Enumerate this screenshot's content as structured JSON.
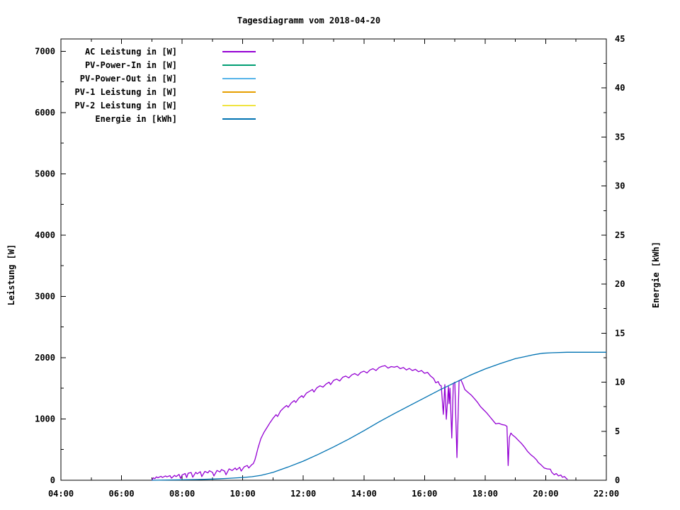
{
  "title": "Tagesdiagramm vom 2018-04-20",
  "chart_data": {
    "type": "line",
    "title": "Tagesdiagramm vom 2018-04-20",
    "grid": false,
    "legend_position": "top-left-inside",
    "x_axis": {
      "label": "",
      "unit": "time",
      "range_hours": [
        4,
        22
      ],
      "major_ticks": [
        {
          "t": 4,
          "label": "04:00"
        },
        {
          "t": 6,
          "label": "06:00"
        },
        {
          "t": 8,
          "label": "08:00"
        },
        {
          "t": 10,
          "label": "10:00"
        },
        {
          "t": 12,
          "label": "12:00"
        },
        {
          "t": 14,
          "label": "14:00"
        },
        {
          "t": 16,
          "label": "16:00"
        },
        {
          "t": 18,
          "label": "18:00"
        },
        {
          "t": 20,
          "label": "20:00"
        },
        {
          "t": 22,
          "label": "22:00"
        }
      ],
      "minor_ticks": [
        5,
        7,
        9,
        11,
        13,
        15,
        17,
        19,
        21
      ]
    },
    "y_axis_left": {
      "label": "Leistung [W]",
      "range": [
        0,
        7200
      ],
      "major_ticks": [
        {
          "v": 0,
          "label": "0"
        },
        {
          "v": 1000,
          "label": "1000"
        },
        {
          "v": 2000,
          "label": "2000"
        },
        {
          "v": 3000,
          "label": "3000"
        },
        {
          "v": 4000,
          "label": "4000"
        },
        {
          "v": 5000,
          "label": "5000"
        },
        {
          "v": 6000,
          "label": "6000"
        },
        {
          "v": 7000,
          "label": "7000"
        }
      ],
      "minor_ticks": [
        500,
        1500,
        2500,
        3500,
        4500,
        5500,
        6500
      ]
    },
    "y_axis_right": {
      "label": "Energie [kWh]",
      "range": [
        0,
        45
      ],
      "major_ticks": [
        {
          "v": 0,
          "label": "0"
        },
        {
          "v": 5,
          "label": "5"
        },
        {
          "v": 10,
          "label": "10"
        },
        {
          "v": 15,
          "label": "15"
        },
        {
          "v": 20,
          "label": "20"
        },
        {
          "v": 25,
          "label": "25"
        },
        {
          "v": 30,
          "label": "30"
        },
        {
          "v": 35,
          "label": "35"
        },
        {
          "v": 40,
          "label": "40"
        },
        {
          "v": 45,
          "label": "45"
        }
      ],
      "minor_ticks": [
        2.5,
        7.5,
        12.5,
        17.5,
        22.5,
        27.5,
        32.5,
        37.5,
        42.5
      ]
    },
    "legend": [
      {
        "label": "AC Leistung in [W]",
        "color": "#9400D3"
      },
      {
        "label": "PV-Power-In in [W]",
        "color": "#009E73"
      },
      {
        "label": "PV-Power-Out in [W]",
        "color": "#56B4E9"
      },
      {
        "label": "PV-1 Leistung in [W]",
        "color": "#E69F00"
      },
      {
        "label": "PV-2 Leistung in [W]",
        "color": "#F0E442"
      },
      {
        "label": "Energie in [kWh]",
        "color": "#0072B2"
      }
    ],
    "series": [
      {
        "name": "AC Leistung in [W]",
        "axis": "left",
        "color": "#9400D3",
        "points": [
          [
            7.0,
            0
          ],
          [
            7.05,
            40
          ],
          [
            7.1,
            25
          ],
          [
            7.15,
            55
          ],
          [
            7.2,
            40
          ],
          [
            7.3,
            65
          ],
          [
            7.35,
            45
          ],
          [
            7.45,
            70
          ],
          [
            7.5,
            55
          ],
          [
            7.6,
            75
          ],
          [
            7.65,
            35
          ],
          [
            7.75,
            80
          ],
          [
            7.8,
            60
          ],
          [
            7.9,
            95
          ],
          [
            7.95,
            30
          ],
          [
            8.0,
            85
          ],
          [
            8.1,
            110
          ],
          [
            8.15,
            45
          ],
          [
            8.2,
            115
          ],
          [
            8.3,
            125
          ],
          [
            8.35,
            50
          ],
          [
            8.45,
            130
          ],
          [
            8.5,
            105
          ],
          [
            8.6,
            140
          ],
          [
            8.65,
            60
          ],
          [
            8.75,
            145
          ],
          [
            8.85,
            120
          ],
          [
            8.9,
            155
          ],
          [
            9.0,
            130
          ],
          [
            9.05,
            70
          ],
          [
            9.15,
            160
          ],
          [
            9.25,
            135
          ],
          [
            9.3,
            175
          ],
          [
            9.4,
            150
          ],
          [
            9.45,
            90
          ],
          [
            9.55,
            185
          ],
          [
            9.65,
            160
          ],
          [
            9.75,
            200
          ],
          [
            9.8,
            170
          ],
          [
            9.9,
            210
          ],
          [
            9.95,
            150
          ],
          [
            10.05,
            220
          ],
          [
            10.15,
            240
          ],
          [
            10.2,
            200
          ],
          [
            10.3,
            255
          ],
          [
            10.35,
            270
          ],
          [
            10.4,
            330
          ],
          [
            10.45,
            420
          ],
          [
            10.5,
            520
          ],
          [
            10.55,
            600
          ],
          [
            10.6,
            680
          ],
          [
            10.7,
            780
          ],
          [
            10.8,
            860
          ],
          [
            10.9,
            940
          ],
          [
            11.0,
            1010
          ],
          [
            11.1,
            1070
          ],
          [
            11.15,
            1040
          ],
          [
            11.25,
            1130
          ],
          [
            11.35,
            1180
          ],
          [
            11.45,
            1220
          ],
          [
            11.5,
            1190
          ],
          [
            11.6,
            1260
          ],
          [
            11.7,
            1300
          ],
          [
            11.75,
            1270
          ],
          [
            11.85,
            1340
          ],
          [
            11.95,
            1380
          ],
          [
            12.0,
            1350
          ],
          [
            12.1,
            1420
          ],
          [
            12.2,
            1450
          ],
          [
            12.3,
            1480
          ],
          [
            12.35,
            1440
          ],
          [
            12.45,
            1510
          ],
          [
            12.55,
            1540
          ],
          [
            12.65,
            1520
          ],
          [
            12.75,
            1570
          ],
          [
            12.85,
            1600
          ],
          [
            12.9,
            1560
          ],
          [
            13.0,
            1630
          ],
          [
            13.1,
            1650
          ],
          [
            13.2,
            1620
          ],
          [
            13.3,
            1680
          ],
          [
            13.4,
            1700
          ],
          [
            13.5,
            1670
          ],
          [
            13.6,
            1720
          ],
          [
            13.7,
            1740
          ],
          [
            13.8,
            1710
          ],
          [
            13.9,
            1760
          ],
          [
            14.0,
            1780
          ],
          [
            14.1,
            1750
          ],
          [
            14.2,
            1800
          ],
          [
            14.3,
            1820
          ],
          [
            14.4,
            1790
          ],
          [
            14.5,
            1840
          ],
          [
            14.6,
            1860
          ],
          [
            14.7,
            1870
          ],
          [
            14.8,
            1830
          ],
          [
            14.9,
            1855
          ],
          [
            15.0,
            1845
          ],
          [
            15.1,
            1860
          ],
          [
            15.2,
            1820
          ],
          [
            15.3,
            1840
          ],
          [
            15.4,
            1800
          ],
          [
            15.5,
            1825
          ],
          [
            15.6,
            1790
          ],
          [
            15.7,
            1810
          ],
          [
            15.8,
            1770
          ],
          [
            15.9,
            1790
          ],
          [
            16.0,
            1745
          ],
          [
            16.1,
            1760
          ],
          [
            16.2,
            1700
          ],
          [
            16.3,
            1660
          ],
          [
            16.37,
            1590
          ],
          [
            16.45,
            1610
          ],
          [
            16.5,
            1555
          ],
          [
            16.55,
            1540
          ],
          [
            16.62,
            1075
          ],
          [
            16.67,
            1560
          ],
          [
            16.72,
            995
          ],
          [
            16.79,
            1530
          ],
          [
            16.81,
            1250
          ],
          [
            16.84,
            1500
          ],
          [
            16.9,
            690
          ],
          [
            16.95,
            1580
          ],
          [
            17.0,
            1600
          ],
          [
            17.07,
            370
          ],
          [
            17.14,
            1620
          ],
          [
            17.2,
            1640
          ],
          [
            17.27,
            1560
          ],
          [
            17.33,
            1480
          ],
          [
            17.42,
            1440
          ],
          [
            17.54,
            1390
          ],
          [
            17.65,
            1330
          ],
          [
            17.75,
            1270
          ],
          [
            17.85,
            1200
          ],
          [
            17.95,
            1150
          ],
          [
            18.05,
            1100
          ],
          [
            18.15,
            1040
          ],
          [
            18.25,
            980
          ],
          [
            18.35,
            920
          ],
          [
            18.45,
            930
          ],
          [
            18.55,
            910
          ],
          [
            18.65,
            900
          ],
          [
            18.72,
            880
          ],
          [
            18.76,
            240
          ],
          [
            18.8,
            700
          ],
          [
            18.85,
            770
          ],
          [
            18.9,
            740
          ],
          [
            19.0,
            700
          ],
          [
            19.1,
            650
          ],
          [
            19.2,
            600
          ],
          [
            19.3,
            540
          ],
          [
            19.4,
            470
          ],
          [
            19.5,
            420
          ],
          [
            19.6,
            380
          ],
          [
            19.7,
            330
          ],
          [
            19.75,
            290
          ],
          [
            19.85,
            250
          ],
          [
            19.95,
            200
          ],
          [
            20.05,
            185
          ],
          [
            20.15,
            180
          ],
          [
            20.2,
            130
          ],
          [
            20.28,
            90
          ],
          [
            20.35,
            110
          ],
          [
            20.42,
            70
          ],
          [
            20.5,
            85
          ],
          [
            20.55,
            50
          ],
          [
            20.62,
            60
          ],
          [
            20.68,
            30
          ],
          [
            20.72,
            15
          ]
        ]
      },
      {
        "name": "PV-Power-In in [W]",
        "axis": "left",
        "color": "#009E73",
        "points": []
      },
      {
        "name": "PV-Power-Out in [W]",
        "axis": "left",
        "color": "#56B4E9",
        "points": []
      },
      {
        "name": "PV-1 Leistung in [W]",
        "axis": "left",
        "color": "#E69F00",
        "points": []
      },
      {
        "name": "PV-2 Leistung in [W]",
        "axis": "left",
        "color": "#F0E442",
        "points": []
      },
      {
        "name": "Energie in [kWh]",
        "axis": "right",
        "color": "#0072B2",
        "points": [
          [
            7.0,
            0
          ],
          [
            8.0,
            0.04
          ],
          [
            8.5,
            0.07
          ],
          [
            9.0,
            0.12
          ],
          [
            9.5,
            0.19
          ],
          [
            10.0,
            0.28
          ],
          [
            10.3,
            0.36
          ],
          [
            10.6,
            0.5
          ],
          [
            11.0,
            0.8
          ],
          [
            11.5,
            1.35
          ],
          [
            12.0,
            1.95
          ],
          [
            12.5,
            2.65
          ],
          [
            13.0,
            3.4
          ],
          [
            13.5,
            4.2
          ],
          [
            14.0,
            5.05
          ],
          [
            14.5,
            5.95
          ],
          [
            15.0,
            6.8
          ],
          [
            15.5,
            7.6
          ],
          [
            16.0,
            8.4
          ],
          [
            16.5,
            9.2
          ],
          [
            17.0,
            9.95
          ],
          [
            17.5,
            10.7
          ],
          [
            18.0,
            11.35
          ],
          [
            18.5,
            11.9
          ],
          [
            19.0,
            12.4
          ],
          [
            19.3,
            12.6
          ],
          [
            19.6,
            12.8
          ],
          [
            19.9,
            12.95
          ],
          [
            20.2,
            13.0
          ],
          [
            20.7,
            13.05
          ],
          [
            21.5,
            13.05
          ],
          [
            22.0,
            13.05
          ]
        ]
      }
    ]
  }
}
